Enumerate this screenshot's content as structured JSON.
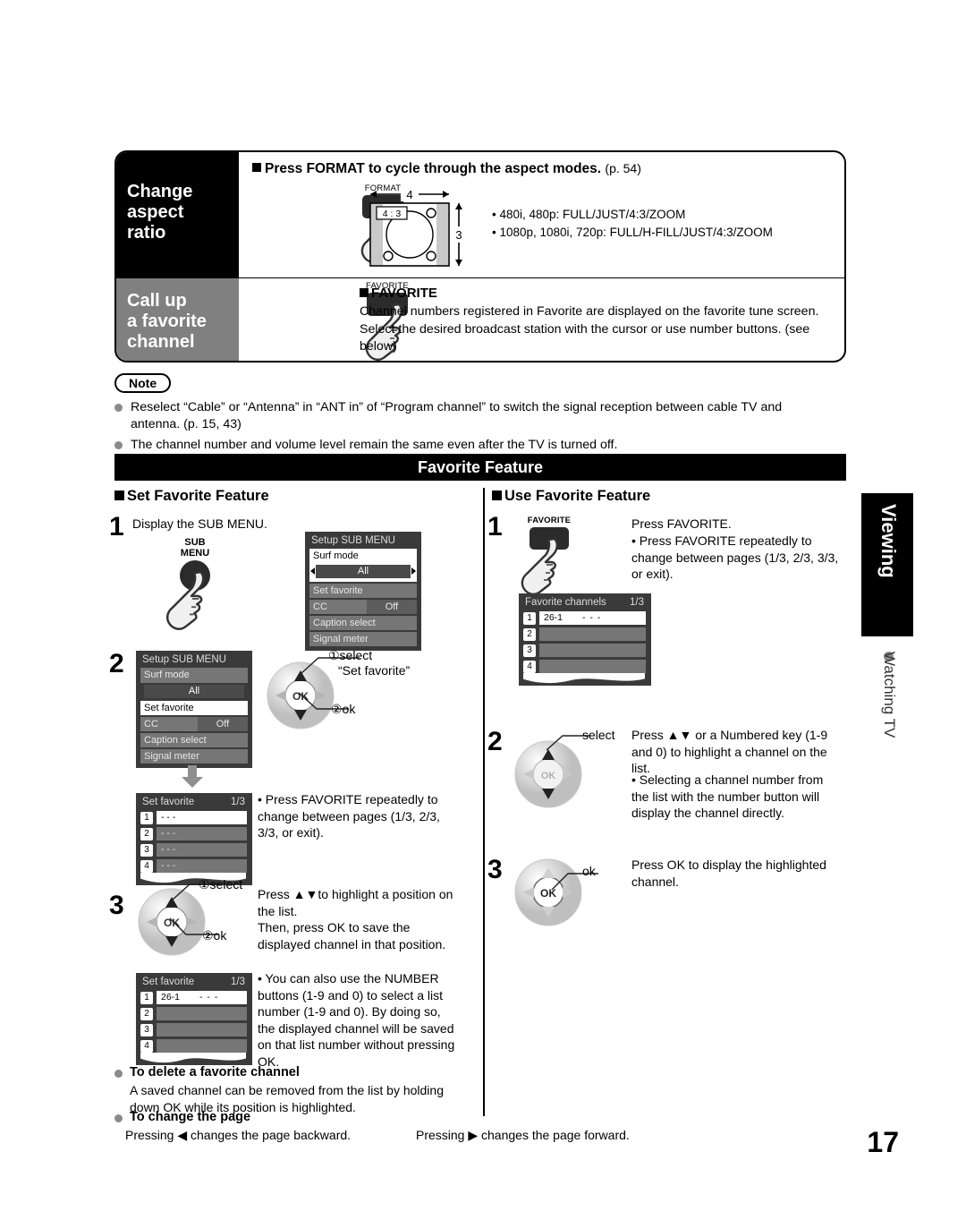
{
  "top_box": {
    "aspect_row": {
      "side_label": "Change\naspect\nratio",
      "heading": "Press FORMAT to cycle through the aspect modes.",
      "heading_page_ref": "(p. 54)",
      "remote_key_label": "FORMAT",
      "diagram": {
        "width_label": "4",
        "height_label": "3",
        "inner_label": "4 : 3"
      },
      "modes": [
        "• 480i, 480p:  FULL/JUST/4:3/ZOOM",
        "• 1080p, 1080i, 720p:  FULL/H-FILL/JUST/4:3/ZOOM"
      ]
    },
    "favorite_row": {
      "side_label": "Call up\na favorite\nchannel",
      "remote_key_label": "FAVORITE",
      "heading": "FAVORITE",
      "body": "Channel numbers registered in Favorite are displayed on the favorite tune screen. Select the desired broadcast station with the cursor or use number buttons. (see below)"
    }
  },
  "note": {
    "label": "Note",
    "items": [
      "Reselect “Cable” or “Antenna” in “ANT in” of “Program channel” to switch the signal reception between cable TV and antenna. (p. 15, 43)",
      "The channel number and volume level remain the same even after the TV is turned off."
    ]
  },
  "band_title": "Favorite Feature",
  "left_column": {
    "heading": "Set Favorite Feature",
    "step1": {
      "num": "1",
      "text": "Display the SUB MENU.",
      "remote_key_label": "SUB\nMENU",
      "menu": {
        "title": "Setup SUB MENU",
        "surf_label": "Surf mode",
        "surf_value": "All",
        "items": [
          {
            "label": "Set favorite",
            "value": ""
          },
          {
            "label": "CC",
            "value": "Off"
          },
          {
            "label": "Caption select",
            "value": ""
          },
          {
            "label": "Signal meter",
            "value": ""
          }
        ]
      }
    },
    "step2": {
      "num": "2",
      "menu": {
        "title": "Setup SUB MENU",
        "surf_label": "Surf mode",
        "surf_value": "All",
        "items": [
          {
            "label": "Set favorite",
            "value": "",
            "selected": true
          },
          {
            "label": "CC",
            "value": "Off"
          },
          {
            "label": "Caption select",
            "value": ""
          },
          {
            "label": "Signal meter",
            "value": ""
          }
        ]
      },
      "pad_note1": "①select",
      "pad_note1b": "“Set favorite”",
      "pad_note2": "②ok",
      "pad_ok": "OK",
      "result_list": {
        "title": "Set favorite",
        "page": "1/3",
        "rows": [
          {
            "num": "1",
            "value": "- - -",
            "selected": true
          },
          {
            "num": "2",
            "value": "- - -"
          },
          {
            "num": "3",
            "value": "- - -"
          },
          {
            "num": "4",
            "value": "- - -"
          }
        ]
      },
      "tip": "• Press FAVORITE repeatedly to change between pages (1/3, 2/3, 3/3, or exit)."
    },
    "step3": {
      "num": "3",
      "pad_note1": "①select",
      "pad_note2": "②ok",
      "pad_ok": "OK",
      "text": "Press ▲▼to highlight a position on the list.\nThen, press OK to save the displayed channel in that position.",
      "result_list": {
        "title": "Set favorite",
        "page": "1/3",
        "rows": [
          {
            "num": "1",
            "value": "26-1",
            "dash": "- - -",
            "selected": true
          },
          {
            "num": "2",
            "value": ""
          },
          {
            "num": "3",
            "value": ""
          },
          {
            "num": "4",
            "value": ""
          }
        ]
      },
      "tip": "• You can also use the NUMBER buttons (1-9 and 0) to select a list number (1-9 and 0). By doing so, the displayed channel will be saved on that list number without pressing OK."
    },
    "delete": {
      "heading": "To delete a favorite channel",
      "body": "A saved channel can be removed from the list by holding down OK while its position is highlighted."
    },
    "change_page": {
      "heading": "To change the page",
      "left_text": "Pressing ◀ changes the page backward.",
      "right_text": "Pressing ▶ changes the page forward."
    }
  },
  "right_column": {
    "heading": "Use Favorite Feature",
    "step1": {
      "num": "1",
      "remote_key_label": "FAVORITE",
      "text": "Press FAVORITE.",
      "tip": "• Press FAVORITE repeatedly to change between pages (1/3, 2/3, 3/3, or exit).",
      "list": {
        "title": "Favorite channels",
        "page": "1/3",
        "rows": [
          {
            "num": "1",
            "value": "26-1",
            "dash": "- - -",
            "selected": true
          },
          {
            "num": "2",
            "value": ""
          },
          {
            "num": "3",
            "value": ""
          },
          {
            "num": "4",
            "value": ""
          }
        ]
      }
    },
    "step2": {
      "num": "2",
      "pad_note": "select",
      "pad_ok": "OK",
      "text": "Press ▲▼ or a Numbered key (1-9 and 0) to highlight a channel on the list.",
      "tip": "• Selecting a channel number from the list with the number button will display the channel directly."
    },
    "step3": {
      "num": "3",
      "pad_note": "ok",
      "pad_ok": "OK",
      "text": "Press OK to display the highlighted channel."
    }
  },
  "side_tab": {
    "chapter": "Viewing",
    "section": "Watching TV"
  },
  "page_number": "17"
}
